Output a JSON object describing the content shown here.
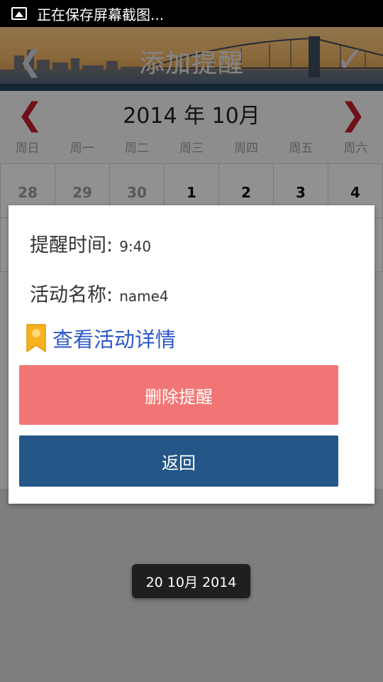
{
  "status_bar": {
    "icon": "image-icon",
    "text": "正在保存屏幕截图..."
  },
  "header": {
    "back_icon": "back-arrow-icon",
    "title": "添加提醒",
    "confirm_icon": "checkmark-icon"
  },
  "calendar": {
    "prev_icon": "chevron-left-icon",
    "next_icon": "chevron-right-icon",
    "month_title": "2014 年 10月",
    "weekdays": [
      "周日",
      "周一",
      "周二",
      "周三",
      "周四",
      "周五",
      "周六"
    ],
    "first_row": [
      "28",
      "29",
      "30",
      "1",
      "2",
      "3",
      "4"
    ]
  },
  "dialog": {
    "time_label": "提醒时间:",
    "time_value": "9:40",
    "name_label": "活动名称:",
    "name_value": "name4",
    "detail_icon": "bookmark-icon",
    "detail_link": "查看活动详情",
    "delete_button": "删除提醒",
    "back_button": "返回"
  },
  "toast": {
    "text": "20 10月 2014"
  },
  "colors": {
    "delete": "#f27575",
    "back": "#245788",
    "link": "#2b57c9",
    "nav_arrow": "#c21d2a"
  }
}
